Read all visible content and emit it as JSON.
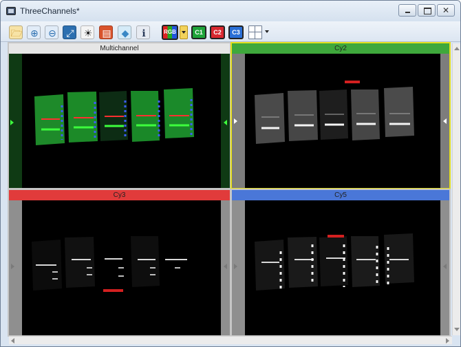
{
  "window": {
    "title": "ThreeChannels*",
    "buttons": {
      "minimize": "",
      "maximize": "",
      "close": "✕"
    }
  },
  "toolbar": {
    "tools": [
      {
        "name": "open-image-icon",
        "glyph": "🗁",
        "color": "#c48a1d",
        "bg": "#f7e3a6"
      },
      {
        "name": "zoom-in-icon",
        "glyph": "⊕",
        "color": "#2c6fb0",
        "bg": "#e1ecf8"
      },
      {
        "name": "zoom-out-icon",
        "glyph": "⊖",
        "color": "#2c6fb0",
        "bg": "#e1ecf8"
      },
      {
        "name": "fit-to-window-icon",
        "glyph": "⤢",
        "color": "#ffffff",
        "bg": "#2c6fb0"
      },
      {
        "name": "brightness-contrast-icon",
        "glyph": "☀",
        "color": "#222222",
        "bg": "#f4f4f4"
      },
      {
        "name": "color-table-icon",
        "glyph": "▤",
        "color": "#ffffff",
        "bg": "#d9532c"
      },
      {
        "name": "properties-icon",
        "glyph": "◆",
        "color": "#3a88c5",
        "bg": "#d5ebf8"
      },
      {
        "name": "info-icon",
        "glyph": "ℹ",
        "color": "#2a3a58",
        "bg": "#e7ebf2"
      }
    ],
    "rgb_label": "RGB",
    "channel_buttons": [
      {
        "name": "channel-c1-button",
        "label": "C1",
        "bg": "#1fa33a"
      },
      {
        "name": "channel-c2-button",
        "label": "C2",
        "bg": "#d8282f"
      },
      {
        "name": "channel-c3-button",
        "label": "C3",
        "bg": "#2a6fd6"
      }
    ],
    "layout_icon": "grid-layout-icon"
  },
  "panes": [
    {
      "label": "Multichannel",
      "header_bg": "#e6e6e6",
      "border": "#c6c6c6",
      "marker": "#3dff3d",
      "side_bg": "#0f3a14"
    },
    {
      "label": "Cy2",
      "header_bg": "#3fa83c",
      "border": "#e6e020",
      "marker": "#ffffff",
      "side_bg": "#7d7d7d"
    },
    {
      "label": "Cy3",
      "header_bg": "#e13b3b",
      "border": "#c6c6c6",
      "marker": "#7a7a7a",
      "side_bg": "#8f8f8f"
    },
    {
      "label": "Cy5",
      "header_bg": "#4a77d8",
      "border": "#c6c6c6",
      "marker": "#7a7a7a",
      "side_bg": "#8f8f8f"
    }
  ]
}
